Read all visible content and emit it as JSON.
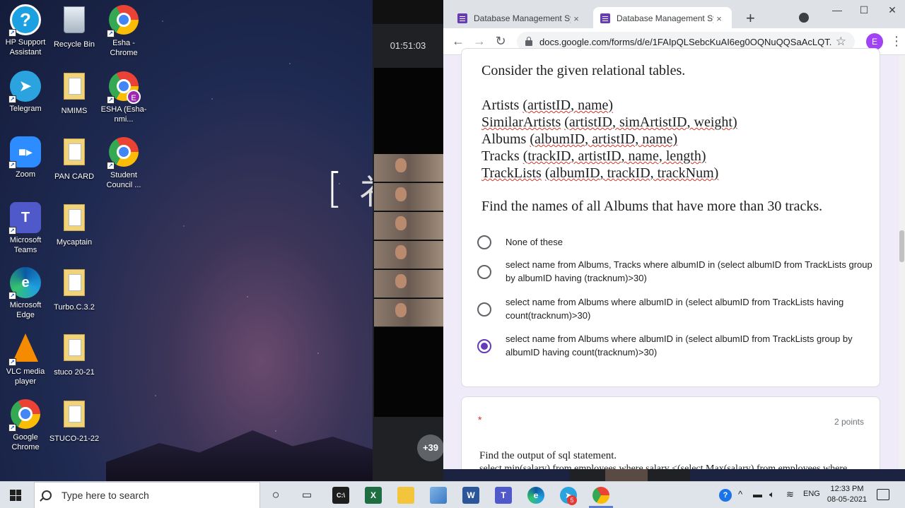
{
  "desktop": {
    "icons": [
      {
        "label": "HP Support Assistant",
        "icon": "help-icon"
      },
      {
        "label": "Recycle Bin",
        "icon": "recycle-bin-icon"
      },
      {
        "label": "Esha - Chrome",
        "icon": "chrome-icon"
      },
      {
        "label": "Telegram",
        "icon": "telegram-icon"
      },
      {
        "label": "NMIMS",
        "icon": "folder-icon"
      },
      {
        "label": "ESHA (Esha-nmi...",
        "icon": "chrome-icon"
      },
      {
        "label": "Zoom",
        "icon": "zoom-icon"
      },
      {
        "label": "PAN CARD",
        "icon": "folder-icon"
      },
      {
        "label": "Student Council ...",
        "icon": "chrome-icon"
      },
      {
        "label": "Microsoft Teams",
        "icon": "teams-icon"
      },
      {
        "label": "Mycaptain",
        "icon": "folder-icon"
      },
      {
        "label": "Microsoft Edge",
        "icon": "edge-icon"
      },
      {
        "label": "Turbo.C.3.2",
        "icon": "folder-icon"
      },
      {
        "label": "VLC media player",
        "icon": "vlc-icon"
      },
      {
        "label": "stuco 20-21",
        "icon": "folder-icon"
      },
      {
        "label": "Google Chrome",
        "icon": "chrome-icon"
      },
      {
        "label": "STUCO-21-22",
        "icon": "folder-icon"
      }
    ],
    "profile_initial": "E",
    "wallpaper_text": "[ 衤"
  },
  "meeting": {
    "timer": "01:51:03",
    "more_participants": "+39",
    "alert": "!"
  },
  "browser": {
    "tabs": [
      {
        "title": "Database Management Syste",
        "close": "×"
      },
      {
        "title": "Database Management Syste",
        "close": "×"
      }
    ],
    "new_tab": "+",
    "window_controls": {
      "minimize": "—",
      "maximize": "☐",
      "close": "✕"
    },
    "url": "docs.google.com/forms/d/e/1FAIpQLSebcKuAI6eg0OQNuQQSaAcLQT...",
    "profile_initial": "E",
    "bookmark_star": "☆",
    "menu": "⋮",
    "nav": {
      "back": "←",
      "forward": "→",
      "reload": "↻"
    }
  },
  "form": {
    "question1": {
      "intro": "Consider the given relational tables.",
      "schema": [
        {
          "name": "Artists",
          "attrs": "(artistID, name)"
        },
        {
          "name": "SimilarArtists",
          "attrs": "(artistID, simArtistID, weight)"
        },
        {
          "name": "Albums",
          "attrs": "(albumID, artistID, name)"
        },
        {
          "name": "Tracks",
          "attrs": "(trackID, artistID, name, length)"
        },
        {
          "name": "TrackLists",
          "attrs": "(albumID, trackID, trackNum)"
        }
      ],
      "prompt": "Find the names of all Albums that have more than 30 tracks.",
      "options": [
        {
          "text": "None of these",
          "selected": false
        },
        {
          "text": "select name from Albums, Tracks where albumID in (select albumID from TrackLists group by albumID having (tracknum)>30)",
          "selected": false
        },
        {
          "text": "select name from Albums where albumID in (select albumID from TrackLists having count(tracknum)>30)",
          "selected": false
        },
        {
          "text": "select name from Albums where albumID in (select albumID from TrackLists group by albumID having count(tracknum)>30)",
          "selected": true
        }
      ]
    },
    "question2": {
      "required_mark": "*",
      "points": "2 points",
      "title": "Find the output of sql statement.",
      "code_partial": "select min(salary) from employees where salary <(select Max(salary) from employees where"
    }
  },
  "taskbar": {
    "search_placeholder": "Type here to search",
    "teams_badge": "",
    "telegram_badge": "5",
    "language": "ENG",
    "time": "12:33 PM",
    "date": "08-05-2021",
    "tray_chevron": "^"
  },
  "colors": {
    "forms_purple": "#673ab7",
    "page_bg": "#f0ebf8",
    "required_red": "#d93025"
  }
}
